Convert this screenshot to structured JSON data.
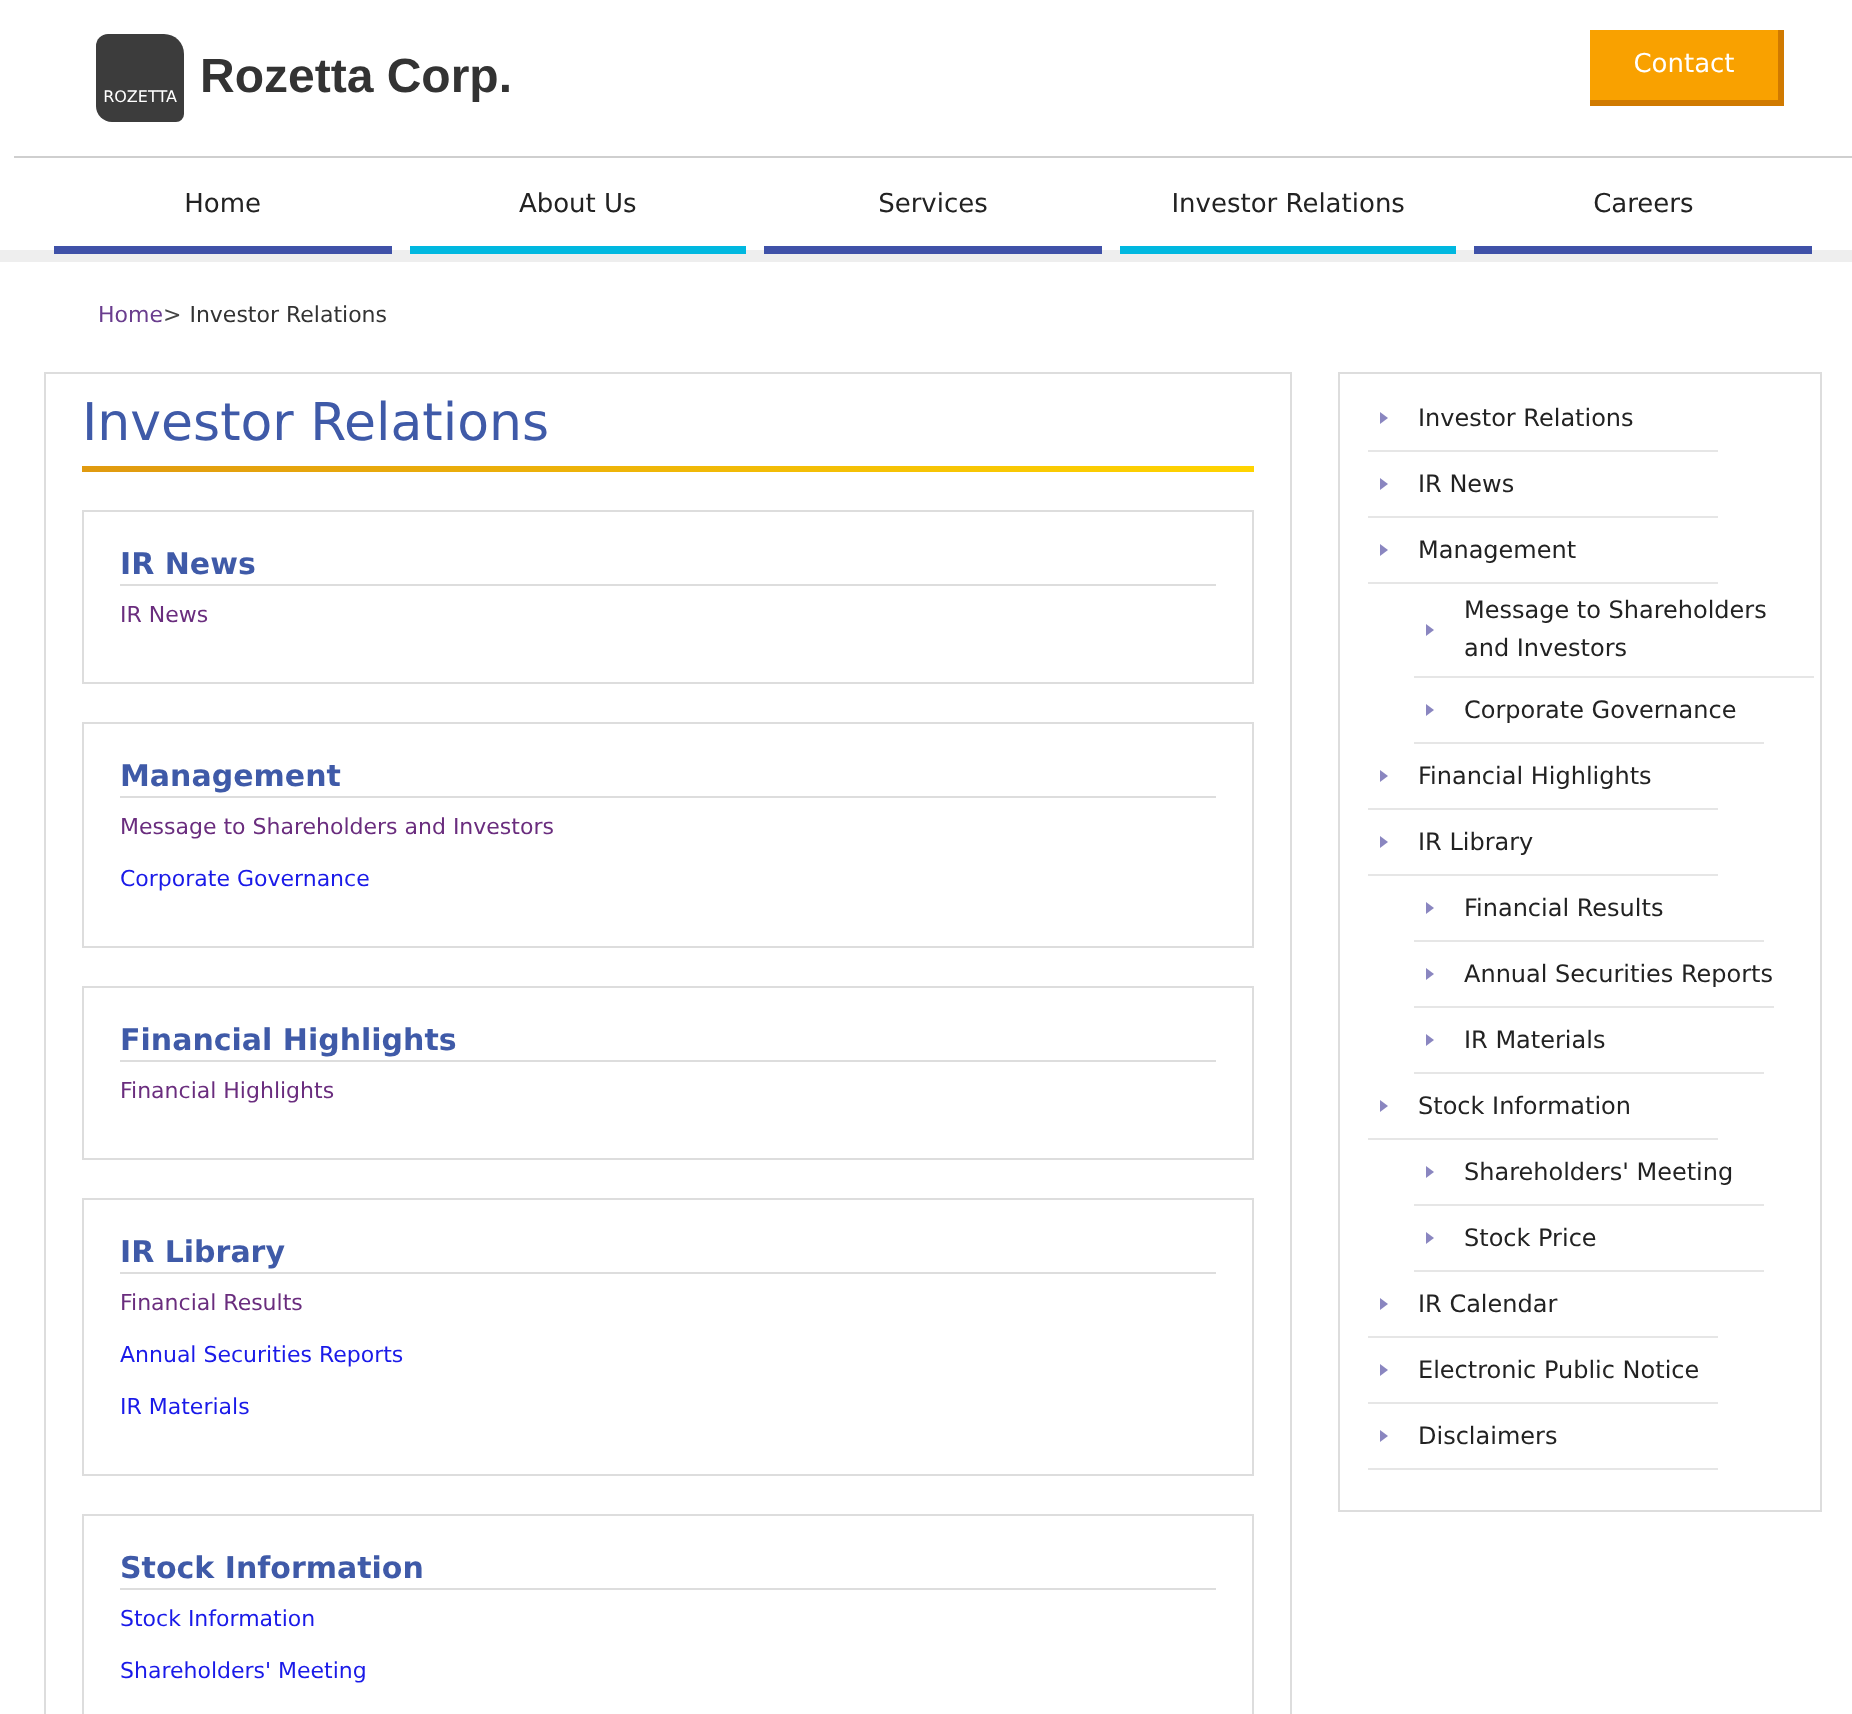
{
  "header": {
    "logo_mark": "ROZETTA",
    "company": "Rozetta Corp.",
    "contact_button": "Contact"
  },
  "nav": [
    {
      "label": "Home",
      "color": "#3f51a8"
    },
    {
      "label": "About Us",
      "color": "#00b8e0"
    },
    {
      "label": "Services",
      "color": "#3f51a8"
    },
    {
      "label": "Investor Relations",
      "color": "#00b8e0"
    },
    {
      "label": "Careers",
      "color": "#3f51a8"
    }
  ],
  "breadcrumb": [
    {
      "label": "Home",
      "kind": "link",
      "separator": ">"
    },
    {
      "label": "Investor Relations",
      "kind": "current"
    }
  ],
  "main": {
    "title": "Investor Relations",
    "sections": [
      {
        "heading": "IR News",
        "links": [
          {
            "label": "IR News",
            "visited": true
          }
        ]
      },
      {
        "heading": "Management",
        "links": [
          {
            "label": "Message to Shareholders and Investors",
            "visited": true
          },
          {
            "label": "Corporate Governance",
            "visited": false
          }
        ]
      },
      {
        "heading": "Financial Highlights",
        "links": [
          {
            "label": "Financial Highlights",
            "visited": true
          }
        ]
      },
      {
        "heading": "IR Library",
        "links": [
          {
            "label": "Financial Results",
            "visited": true
          },
          {
            "label": "Annual Securities Reports",
            "visited": false
          },
          {
            "label": "IR Materials",
            "visited": false
          }
        ]
      },
      {
        "heading": "Stock Information",
        "links": [
          {
            "label": "Stock Information",
            "visited": false
          },
          {
            "label": "Shareholders' Meeting",
            "visited": false
          }
        ]
      }
    ]
  },
  "sidebar": {
    "items": [
      {
        "label": "Investor Relations"
      },
      {
        "label": "IR News"
      },
      {
        "label": "Management",
        "children": [
          {
            "label": "Message to Shareholders and Investors"
          },
          {
            "label": "Corporate Governance"
          }
        ]
      },
      {
        "label": "Financial Highlights"
      },
      {
        "label": "IR Library",
        "children": [
          {
            "label": "Financial Results"
          },
          {
            "label": "Annual Securities Reports"
          },
          {
            "label": "IR Materials"
          }
        ]
      },
      {
        "label": "Stock Information",
        "children": [
          {
            "label": "Shareholders' Meeting"
          },
          {
            "label": "Stock Price"
          }
        ]
      },
      {
        "label": "IR Calendar"
      },
      {
        "label": "Electronic Public Notice"
      },
      {
        "label": "Disclaimers"
      }
    ]
  }
}
